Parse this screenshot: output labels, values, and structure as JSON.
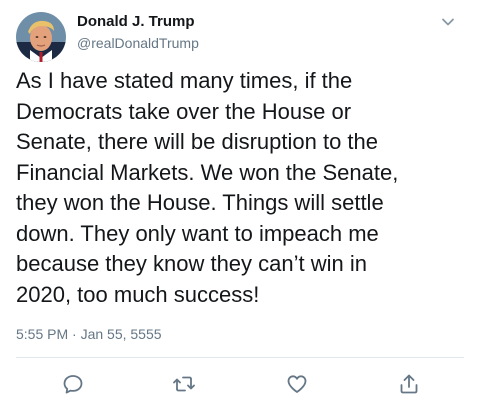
{
  "author": {
    "name": "Donald J. Trump",
    "handle": "@realDonaldTrump",
    "avatar_icon": "avatar-portrait"
  },
  "tweet": {
    "text": "As I have stated many times, if the\nDemocrats take over the House or\nSenate, there will be disruption to the\nFinancial Markets. We won the Senate,\nthey won the House. Things will settle\ndown. They only want to impeach me\nbecause they know they can’t win in\n2020, too much success!",
    "timestamp": "5:55 PM · Jan 55, 5555"
  },
  "actions": [
    {
      "name": "reply",
      "icon": "reply-icon"
    },
    {
      "name": "retweet",
      "icon": "retweet-icon"
    },
    {
      "name": "like",
      "icon": "heart-icon"
    },
    {
      "name": "share",
      "icon": "share-icon"
    }
  ],
  "colors": {
    "text": "#14171a",
    "secondary": "#657786",
    "divider": "#e1e8ed",
    "icon": "#657786"
  }
}
